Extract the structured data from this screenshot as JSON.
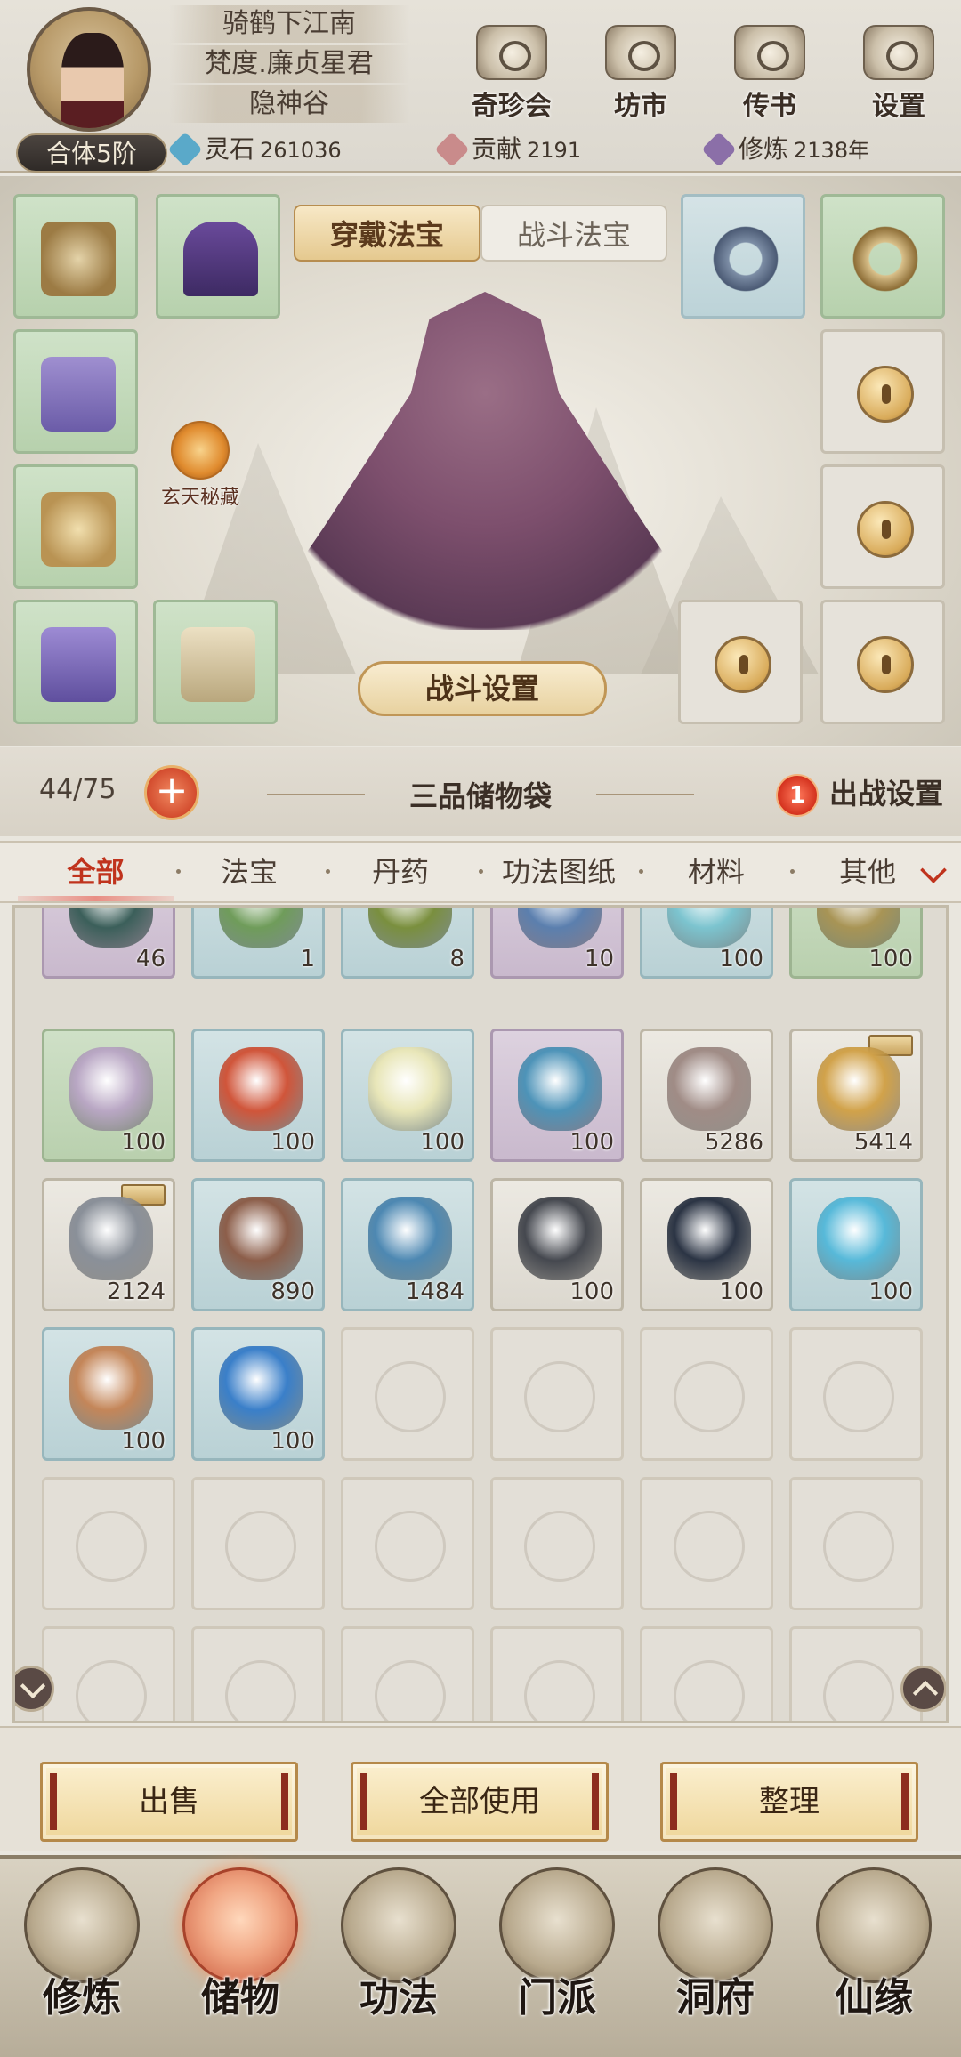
{
  "profile": {
    "rank": "合体5阶",
    "lines": [
      "骑鹤下江南",
      "梵度.廉贞星君",
      "隐神谷"
    ]
  },
  "top_buttons": [
    "奇珍会",
    "坊市",
    "传书",
    "设置"
  ],
  "resources": [
    {
      "label": "灵石",
      "value": "261036",
      "color": "#5aa9c9"
    },
    {
      "label": "贡献",
      "value": "2191",
      "color": "#c98b8b"
    },
    {
      "label": "修炼",
      "value": "2138年",
      "color": "#8b6fa8"
    }
  ],
  "equip_tabs": {
    "active": "穿戴法宝",
    "inactive": "战斗法宝"
  },
  "secret_label": "玄天秘藏",
  "battle_settings_label": "战斗设置",
  "bag": {
    "capacity": "44/75",
    "plus": "+",
    "title": "三品储物袋",
    "deploy_badge": "1",
    "deploy_label": "出战设置"
  },
  "filters": [
    "全部",
    "法宝",
    "丹药",
    "功法图纸",
    "材料",
    "其他"
  ],
  "items_row1": [
    {
      "qty": "46",
      "rarity": "r-purple",
      "color": "#3b5f5a"
    },
    {
      "qty": "1",
      "rarity": "r-blue",
      "color": "#6f9c5a"
    },
    {
      "qty": "8",
      "rarity": "r-blue",
      "color": "#7a8f3e"
    },
    {
      "qty": "10",
      "rarity": "r-purple",
      "color": "#5b7fae"
    },
    {
      "qty": "100",
      "rarity": "r-blue",
      "color": "#7cc4cf"
    },
    {
      "qty": "100",
      "rarity": "r-green",
      "color": "#a89455"
    }
  ],
  "items_row2": [
    {
      "qty": "100",
      "rarity": "r-green",
      "color": "#b9a7c4"
    },
    {
      "qty": "100",
      "rarity": "r-blue",
      "color": "#d0553a"
    },
    {
      "qty": "100",
      "rarity": "r-blue",
      "color": "#e8e6b8"
    },
    {
      "qty": "100",
      "rarity": "r-purple",
      "color": "#4d93b8"
    },
    {
      "qty": "5286",
      "rarity": "r-gray",
      "color": "#a08c86"
    },
    {
      "qty": "5414",
      "rarity": "r-gray",
      "color": "#d1a24a",
      "tag": true
    }
  ],
  "items_row3": [
    {
      "qty": "2124",
      "rarity": "r-gray",
      "color": "#8a9099",
      "tag": true
    },
    {
      "qty": "890",
      "rarity": "r-blue",
      "color": "#8c5e4a"
    },
    {
      "qty": "1484",
      "rarity": "r-blue",
      "color": "#4d88b2"
    },
    {
      "qty": "100",
      "rarity": "r-gray",
      "color": "#45484f"
    },
    {
      "qty": "100",
      "rarity": "r-gray",
      "color": "#2b3444"
    },
    {
      "qty": "100",
      "rarity": "r-blue",
      "color": "#57b9d9"
    }
  ],
  "items_row4": [
    {
      "qty": "100",
      "rarity": "r-blue",
      "color": "#c48659"
    },
    {
      "qty": "100",
      "rarity": "r-blue",
      "color": "#3a7fc9"
    }
  ],
  "actions": [
    "出售",
    "全部使用",
    "整理"
  ],
  "nav": [
    "修炼",
    "储物",
    "功法",
    "门派",
    "洞府",
    "仙缘"
  ],
  "nav_active": "储物"
}
